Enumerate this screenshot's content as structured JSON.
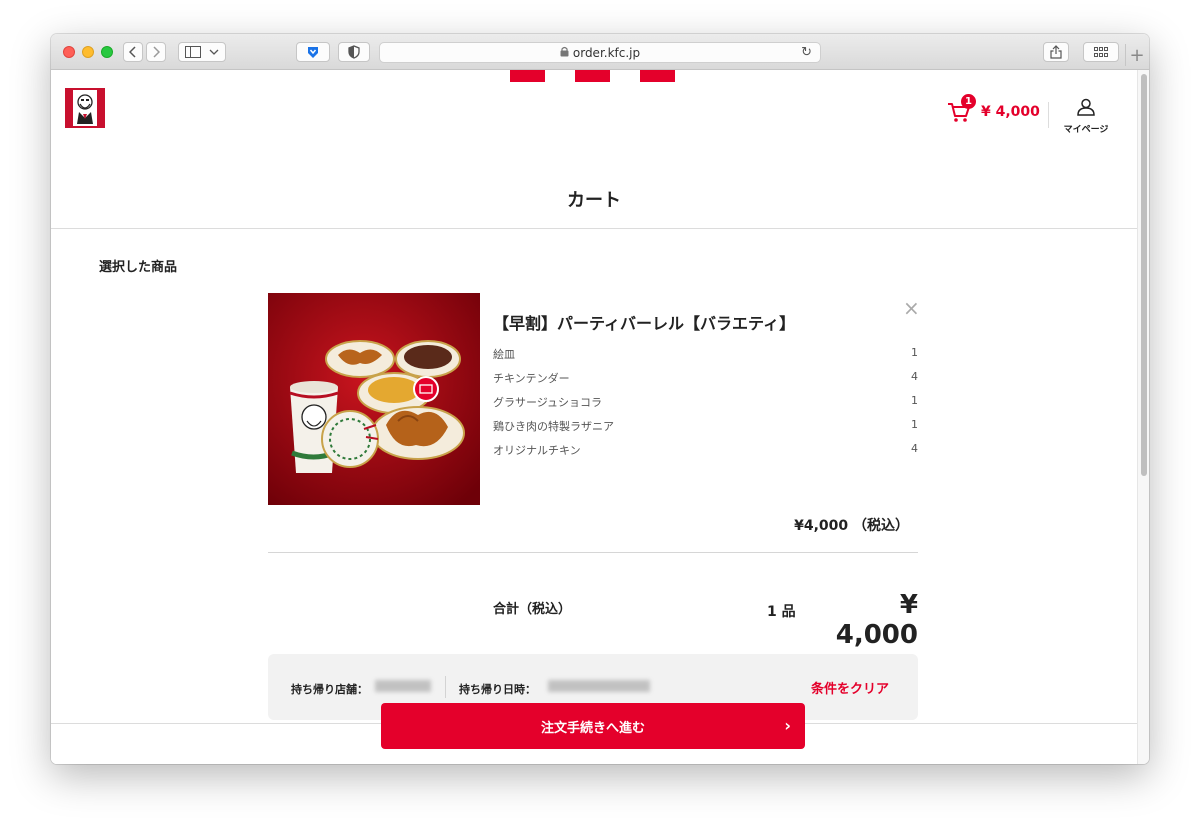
{
  "browser": {
    "url": "order.kfc.jp",
    "reload_icon": "↻",
    "new_tab_icon": "+"
  },
  "header": {
    "cart_badge": "1",
    "cart_total": "¥ 4,000",
    "mypage_label": "マイページ"
  },
  "page": {
    "title": "カート",
    "section_label": "選択した商品"
  },
  "product": {
    "name": "【早割】パーティバーレル【バラエティ】",
    "remove_icon": "×",
    "items": [
      {
        "name": "絵皿",
        "qty": "1"
      },
      {
        "name": "チキンテンダー",
        "qty": "4"
      },
      {
        "name": "グラサージュショコラ",
        "qty": "1"
      },
      {
        "name": "鶏ひき肉の特製ラザニア",
        "qty": "1"
      },
      {
        "name": "オリジナルチキン",
        "qty": "4"
      }
    ],
    "price": "¥4,000 （税込）"
  },
  "totals": {
    "label": "合計（税込）",
    "count": "1 品",
    "price": "¥ 4,000"
  },
  "pickup": {
    "store_label": "持ち帰り店舗：",
    "datetime_label": "持ち帰り日時：",
    "clear_label": "条件をクリア"
  },
  "checkout": {
    "label": "注文手続きへ進む",
    "chevron": "›"
  },
  "colors": {
    "brand_red": "#e4002b",
    "text": "#222222"
  }
}
